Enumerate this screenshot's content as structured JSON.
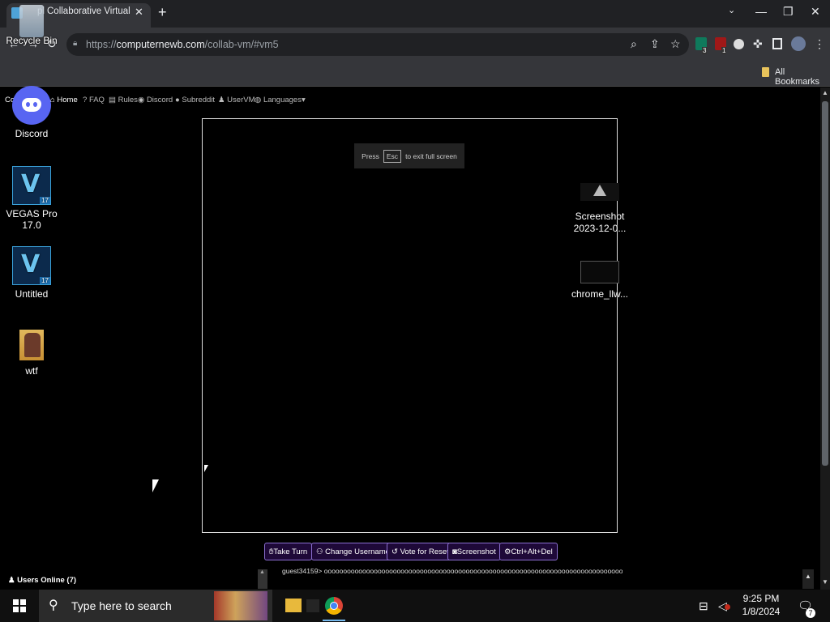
{
  "browser": {
    "tab_title": "Collaborative Virtual Ma",
    "tab_title_prefix": "pl",
    "url_host": "computernewb.com",
    "url_scheme": "https://",
    "url_path": "/collab-vm/#vm5",
    "all_bookmarks": "All Bookmarks",
    "ext_badge_1": "3",
    "ext_badge_2": "1"
  },
  "nav": {
    "brand": "Co",
    "items": [
      {
        "label": "Home",
        "icon": "home-icon"
      },
      {
        "label": "FAQ",
        "icon": "question-icon"
      },
      {
        "label": "Rules",
        "icon": "rules-icon"
      },
      {
        "label": "Discord",
        "icon": "discord-icon"
      },
      {
        "label": "Subreddit",
        "icon": "reddit-icon"
      },
      {
        "label": "UserVM",
        "icon": "user-icon"
      },
      {
        "label": "Languages",
        "icon": "globe-icon"
      }
    ]
  },
  "vm": {
    "esc_press": "Press",
    "esc_key": "Esc",
    "esc_rest": "to exit full screen"
  },
  "desktop_icons": [
    {
      "label": "Recycle Bin"
    },
    {
      "label": "Discord"
    },
    {
      "label": "VEGAS Pro 17.0"
    },
    {
      "label": "Untitled"
    },
    {
      "label": "wtf"
    },
    {
      "label": "Screenshot 2023-12-0..."
    },
    {
      "label": "chrome_llw..."
    }
  ],
  "vegas_badge": "17",
  "actions": [
    {
      "label": "Take Turn"
    },
    {
      "label": "Change Username"
    },
    {
      "label": "Vote for Reset"
    },
    {
      "label": "Screenshot"
    },
    {
      "label": "Ctrl+Alt+Del"
    }
  ],
  "users_online": "Users Online (7)",
  "chat": {
    "line": "guest34159> oooooooooooooooooooooooooooooooooooooooooooooooooooooooooooooooooooooooooooooooooooooooooo"
  },
  "taskbar": {
    "search_placeholder": "Type here to search",
    "time": "9:25 PM",
    "date": "1/8/2024",
    "notif_count": "7"
  },
  "colors": {
    "accent_button_border": "#8b6fd0",
    "accent_button_bg": "#1e0938",
    "chrome_dark": "#202124",
    "chrome_toolbar": "#35363a"
  }
}
